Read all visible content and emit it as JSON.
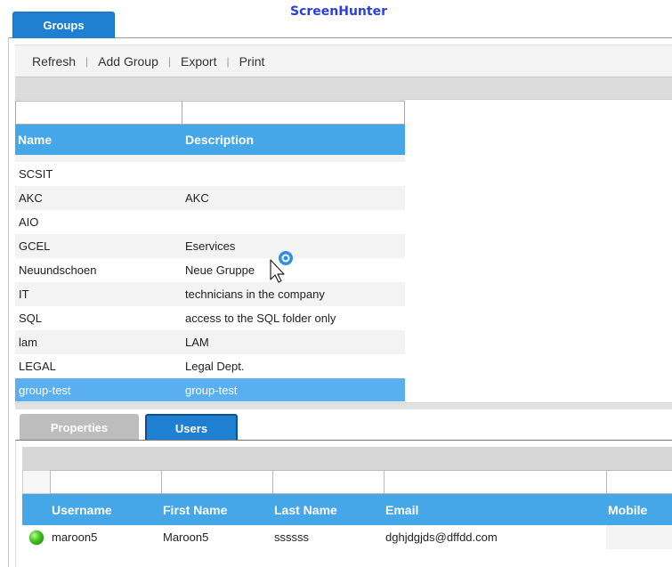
{
  "watermark": "ScreenHunter",
  "tabs": {
    "groups": "Groups"
  },
  "toolbar": {
    "refresh": "Refresh",
    "add_group": "Add Group",
    "export": "Export",
    "print": "Print",
    "separator": "|"
  },
  "groups_grid": {
    "columns": {
      "name": "Name",
      "description": "Description"
    },
    "rows": [
      {
        "name": "SCSIT",
        "description": ""
      },
      {
        "name": "AKC",
        "description": "AKC"
      },
      {
        "name": "AIO",
        "description": ""
      },
      {
        "name": "GCEL",
        "description": "Eservices"
      },
      {
        "name": "Neuundschoen",
        "description": "Neue Gruppe"
      },
      {
        "name": "IT",
        "description": "technicians in the company"
      },
      {
        "name": "SQL",
        "description": "access to the SQL folder only"
      },
      {
        "name": "lam",
        "description": "LAM"
      },
      {
        "name": "LEGAL",
        "description": "Legal Dept."
      },
      {
        "name": "group-test",
        "description": "group-test"
      }
    ],
    "selected_row": "group-test"
  },
  "detail_tabs": {
    "properties": "Properties",
    "users": "Users",
    "active": "Users"
  },
  "users_grid": {
    "columns": {
      "username": "Username",
      "first_name": "First Name",
      "last_name": "Last Name",
      "email": "Email",
      "mobile": "Mobile"
    },
    "rows": [
      {
        "status_icon": "online-status-icon",
        "username": "maroon5",
        "first_name": "Maroon5",
        "last_name": "ssssss",
        "email": "dghjdgjds@dffdd.com",
        "mobile": ""
      }
    ]
  },
  "colors": {
    "accent": "#45a6e8",
    "tab_active": "#1f7fd1",
    "selected_row": "#5aaff0",
    "watermark": "#2a3fe0"
  }
}
